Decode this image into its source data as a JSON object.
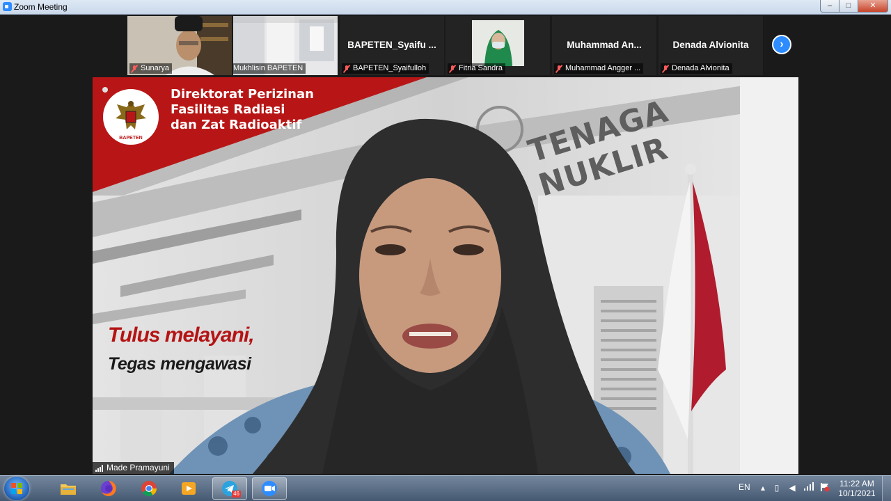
{
  "window": {
    "title": "Zoom Meeting",
    "controls": [
      "–",
      "□",
      "✕"
    ]
  },
  "participants": [
    {
      "name": "Sunarya",
      "video": true
    },
    {
      "name": "Mukhlisin BAPETEN",
      "video": true
    },
    {
      "name": "BAPETEN_Syaifulloh",
      "display": "BAPETEN_Syaifu ...",
      "video": false
    },
    {
      "name": "Fitria Sandra",
      "video": true
    },
    {
      "name": "Muhammad Angger ...",
      "display": "Muhammad  An...",
      "video": false
    },
    {
      "name": "Denada Alvionita",
      "display": "Denada Alvionita",
      "video": false
    }
  ],
  "next_button": "›",
  "main_video": {
    "banner": {
      "line1": "Direktorat Perizinan",
      "line2": "Fasilitas Radiasi",
      "line3": "dan Zat Radioaktif"
    },
    "emblem_text": "BAPETEN",
    "building_sign": "TENAGA NUKLIR",
    "slogan": {
      "line1": "Tulus melayani,",
      "line2": "Tegas mengawasi"
    },
    "speaker": "Made Pramayuni"
  },
  "taskbar": {
    "apps": [
      {
        "name": "File Explorer",
        "icon": "folder-icon"
      },
      {
        "name": "Firefox",
        "icon": "firefox-icon"
      },
      {
        "name": "Chrome",
        "icon": "chrome-icon"
      },
      {
        "name": "Media Player",
        "icon": "media-player-icon"
      },
      {
        "name": "Telegram",
        "icon": "telegram-icon",
        "badge": "46"
      },
      {
        "name": "Zoom",
        "icon": "zoom-icon",
        "active": true
      }
    ],
    "language": "EN",
    "time": "11:22 AM",
    "date": "10/1/2021"
  },
  "colors": {
    "zoom_blue": "#2d8cff",
    "banner_red": "#b81616",
    "muted_red": "#ff5b5b"
  }
}
